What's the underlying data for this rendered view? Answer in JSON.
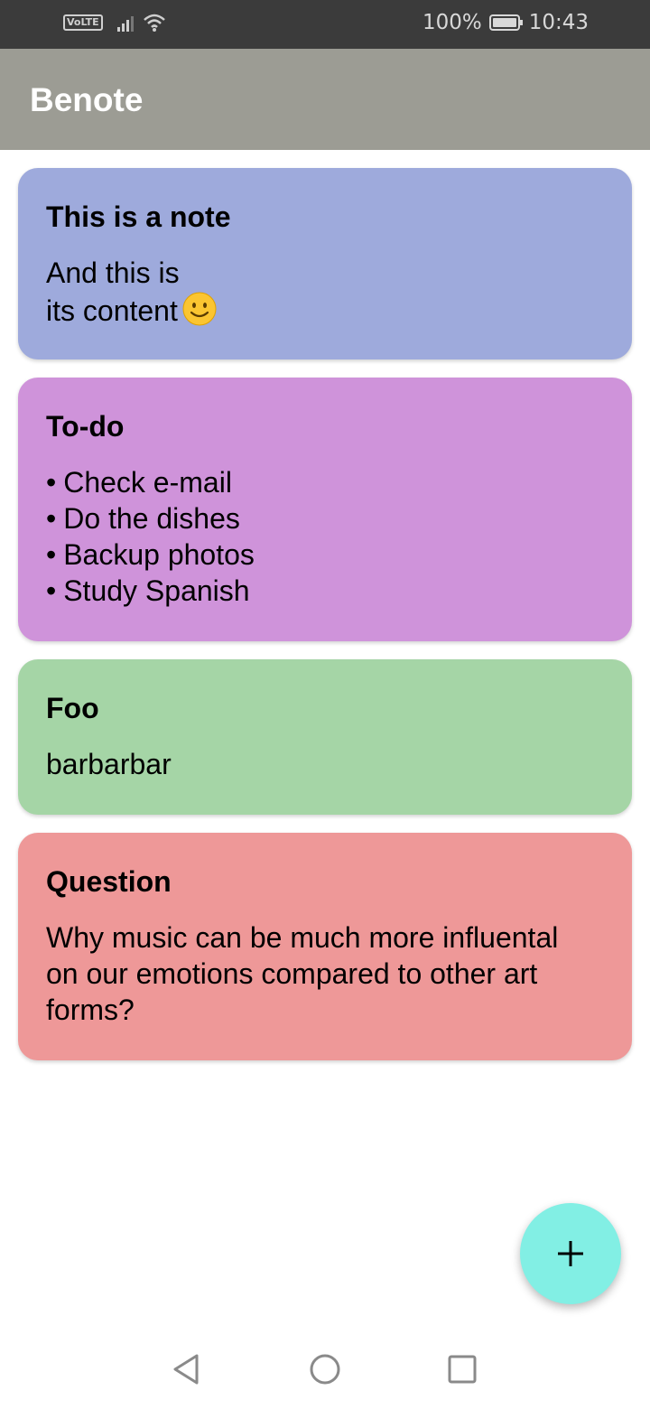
{
  "status_bar": {
    "network_badge": "VoLTE",
    "battery_percent": "100%",
    "time": "10:43",
    "icons": [
      "volte-icon",
      "signal-icon",
      "wifi-icon",
      "battery-icon"
    ]
  },
  "app_bar": {
    "title": "Benote",
    "color": "#9c9c94"
  },
  "notes": [
    {
      "title": "This is a note",
      "body_line1": "And this is",
      "body_line2": "its content",
      "emoji": "smiling-face-icon",
      "color": "#9eaadc"
    },
    {
      "title": "To-do",
      "items": [
        "Check e-mail",
        "Do the dishes",
        "Backup photos",
        "Study Spanish"
      ],
      "color": "#cf93da"
    },
    {
      "title": "Foo",
      "body": "barbarbar",
      "color": "#a5d5a6"
    },
    {
      "title": "Question",
      "body": "Why music can be much more influental\non our emotions compared to other art\nforms?",
      "color": "#ee9898"
    }
  ],
  "fab": {
    "icon": "plus-icon",
    "color": "#82efe4"
  },
  "nav_bar": {
    "icons": [
      "back-icon",
      "home-icon",
      "recents-icon"
    ]
  }
}
